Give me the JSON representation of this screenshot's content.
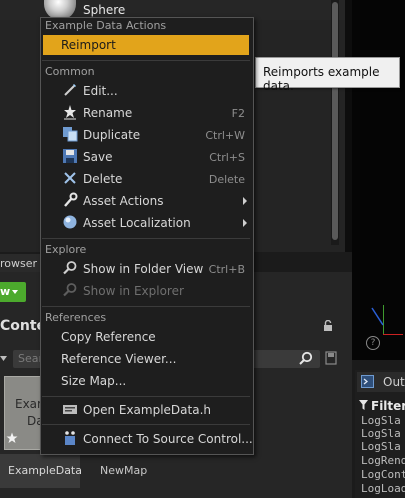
{
  "top_row": {
    "object_label": "Sphere"
  },
  "browser": {
    "tab_label": "rowser",
    "add_label": "w",
    "content_title": "Conter",
    "search_placeholder": "Searc",
    "asset_tile": {
      "line1": "Exam",
      "line2": "Da"
    },
    "tabs": [
      "ExampleData",
      "NewMap"
    ]
  },
  "tooltip": {
    "text": "Reimports  example data."
  },
  "menu": {
    "header": "Example Data Actions",
    "reimport": "Reimport",
    "sections": {
      "common": "Common",
      "explore": "Explore",
      "references": "References"
    },
    "common_items": [
      {
        "label": "Edit...",
        "shortcut": "",
        "icon": "pencil-icon"
      },
      {
        "label": "Rename",
        "shortcut": "F2",
        "icon": "rename-star-icon"
      },
      {
        "label": "Duplicate",
        "shortcut": "Ctrl+W",
        "icon": "duplicate-icon"
      },
      {
        "label": "Save",
        "shortcut": "Ctrl+S",
        "icon": "save-icon"
      },
      {
        "label": "Delete",
        "shortcut": "Delete",
        "icon": "delete-x-icon"
      },
      {
        "label": "Asset Actions",
        "shortcut": "",
        "icon": "wrench-icon"
      },
      {
        "label": "Asset Localization",
        "shortcut": "",
        "icon": "globe-icon"
      }
    ],
    "explore_items": [
      {
        "label": "Show in Folder View",
        "shortcut": "Ctrl+B",
        "icon": "magnifier-icon"
      },
      {
        "label": "Show in Explorer",
        "shortcut": "",
        "icon": "magnifier-icon"
      }
    ],
    "reference_items": [
      {
        "label": "Copy Reference"
      },
      {
        "label": "Reference Viewer..."
      },
      {
        "label": "Size Map..."
      }
    ],
    "open_item": {
      "label": "Open ExampleData.h",
      "icon": "code-file-icon"
    },
    "source_control_item": {
      "label": "Connect To Source Control...",
      "icon": "source-control-icon"
    }
  },
  "output_log": {
    "title": "Outp",
    "filters_label": "Filters",
    "lines": [
      "LogSla",
      "LogSla",
      "LogSla",
      "LogRend",
      "LogCont",
      "LogLoad"
    ]
  },
  "viewport": {
    "help_glyph": "?"
  },
  "colors": {
    "accent_highlight": "#e2a41b",
    "add_button": "#4caa2d",
    "gizmo_x": "#cc2222",
    "gizmo_y": "#3e9a2e"
  }
}
